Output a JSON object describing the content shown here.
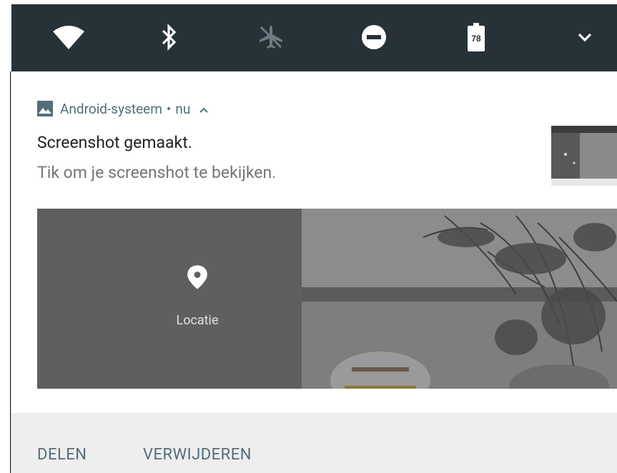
{
  "quick_settings": {
    "background": "#263238",
    "icons": [
      {
        "name": "wifi-icon",
        "state": "on"
      },
      {
        "name": "bluetooth-icon",
        "state": "on"
      },
      {
        "name": "airplane-mode-icon",
        "state": "off"
      },
      {
        "name": "do-not-disturb-icon",
        "state": "on"
      },
      {
        "name": "battery-icon",
        "state": "on"
      },
      {
        "name": "expand-chevron-icon",
        "state": "on"
      }
    ],
    "battery_level": "78"
  },
  "notification": {
    "app_icon": "image-icon",
    "app_name": "Android-systeem",
    "separator": "•",
    "time": "nu",
    "title": "Screenshot gemaakt.",
    "text": "Tik om je screenshot te bekijken.",
    "preview": {
      "tile_label": "Locatie",
      "tile_icon": "location-pin-icon"
    },
    "actions": [
      {
        "label": "DELEN"
      },
      {
        "label": "VERWIJDEREN"
      }
    ],
    "accent_color": "#546e7a"
  }
}
